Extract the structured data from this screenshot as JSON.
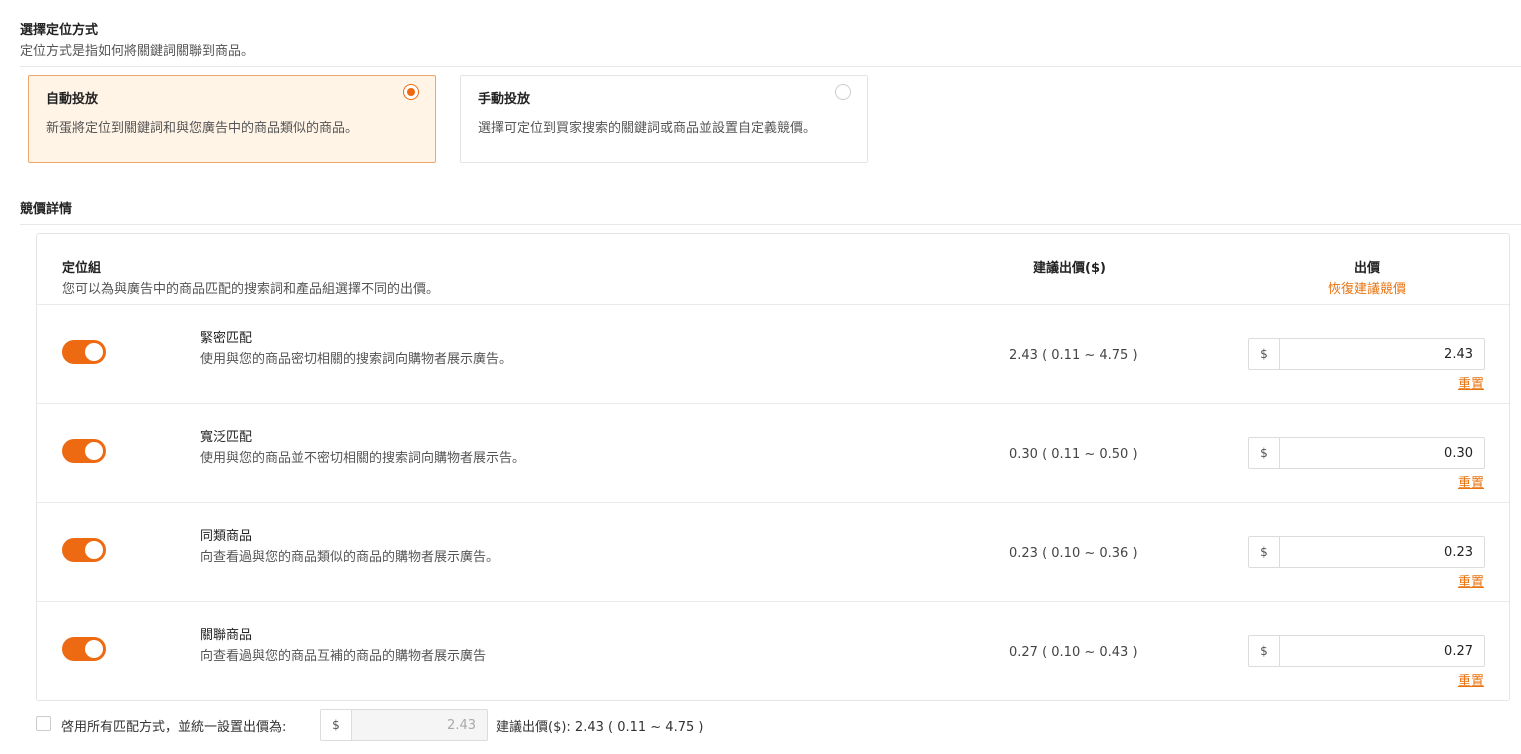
{
  "targeting": {
    "title": "選擇定位方式",
    "description": "定位方式是指如何將關鍵詞關聯到商品。",
    "options": [
      {
        "title": "自動投放",
        "description": "新蛋將定位到關鍵詞和與您廣告中的商品類似的商品。",
        "selected": true
      },
      {
        "title": "手動投放",
        "description": "選擇可定位到買家搜索的關鍵詞或商品並設置自定義競價。",
        "selected": false
      }
    ]
  },
  "bid": {
    "title": "競價詳情",
    "header": {
      "group_label": "定位組",
      "group_desc": "您可以為與廣告中的商品匹配的搜索詞和產品組選擇不同的出價。",
      "suggest_label": "建議出價($)",
      "bid_label": "出價",
      "restore_label": "恢復建議競價"
    },
    "rows": [
      {
        "name": "緊密匹配",
        "description": "使用與您的商品密切相關的搜索詞向購物者展示廣告。",
        "suggested": "2.43 ( 0.11 ~ 4.75 )",
        "currency": "$",
        "value": "2.43",
        "reset": "重置",
        "enabled": true
      },
      {
        "name": "寬泛匹配",
        "description": "使用與您的商品並不密切相關的搜索詞向購物者展示告。",
        "suggested": "0.30 ( 0.11 ~ 0.50 )",
        "currency": "$",
        "value": "0.30",
        "reset": "重置",
        "enabled": true
      },
      {
        "name": "同類商品",
        "description": "向查看過與您的商品類似的商品的購物者展示廣告。",
        "suggested": "0.23 ( 0.10 ~ 0.36 )",
        "currency": "$",
        "value": "0.23",
        "reset": "重置",
        "enabled": true
      },
      {
        "name": "關聯商品",
        "description": "向查看過與您的商品互補的商品的購物者展示廣告",
        "suggested": "0.27 ( 0.10 ~ 0.43 )",
        "currency": "$",
        "value": "0.27",
        "reset": "重置",
        "enabled": true
      }
    ],
    "footer": {
      "checkbox_label": "啓用所有匹配方式，並統一設置出價為:",
      "checked": false,
      "currency": "$",
      "value": "2.43",
      "suggest_text": "建議出價($):  2.43 ( 0.11 ~ 4.75 )"
    }
  },
  "colors": {
    "accent": "#ee6a12",
    "selected_card_bg": "#fff4e6",
    "link": "#e8730f"
  }
}
